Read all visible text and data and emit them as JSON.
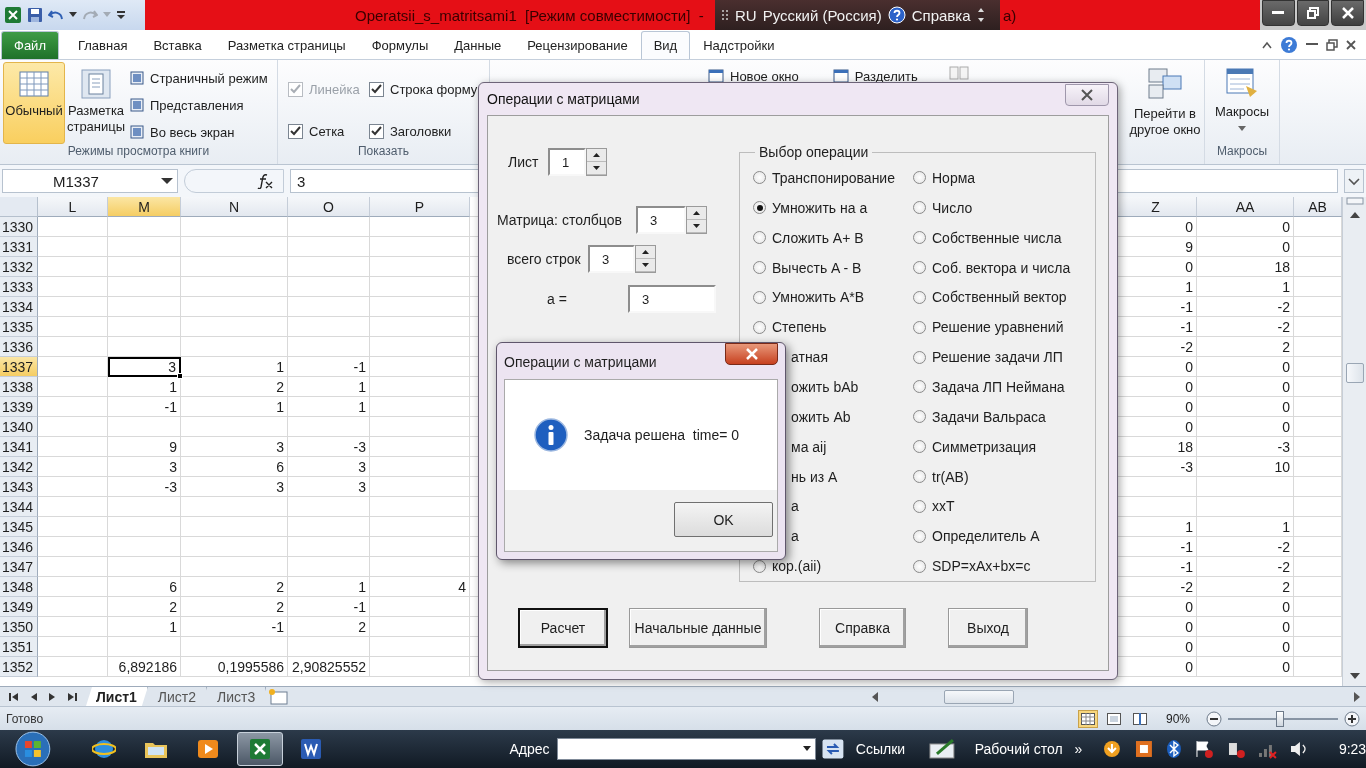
{
  "title_bar": {
    "title": "Operatsii_s_matritsami1  [Режим совместимости]  -",
    "title_tail": "a)"
  },
  "language_bar": {
    "code": "RU",
    "language": "Русский (Россия)",
    "help": "Справка"
  },
  "ribbon_tabs": [
    {
      "label": "Файл",
      "kind": "file",
      "selected": false
    },
    {
      "label": "Главная",
      "kind": "tab",
      "selected": false
    },
    {
      "label": "Вставка",
      "kind": "tab",
      "selected": false
    },
    {
      "label": "Разметка страницы",
      "kind": "tab",
      "selected": false
    },
    {
      "label": "Формулы",
      "kind": "tab",
      "selected": false
    },
    {
      "label": "Данные",
      "kind": "tab",
      "selected": false
    },
    {
      "label": "Рецензирование",
      "kind": "tab",
      "selected": false
    },
    {
      "label": "Вид",
      "kind": "tab",
      "selected": true
    },
    {
      "label": "Надстройки",
      "kind": "tab",
      "selected": false
    }
  ],
  "ribbon": {
    "views": {
      "label": "Режимы просмотра книги",
      "large_buttons": [
        {
          "label": "Обычный",
          "selected": true
        },
        {
          "label": "Разметка страницы",
          "selected": false
        }
      ],
      "small_buttons": [
        "Страничный режим",
        "Представления",
        "Во весь экран"
      ]
    },
    "show": {
      "label": "Показать",
      "checkboxes": [
        {
          "label": "Линейка",
          "checked": true,
          "disabled": true
        },
        {
          "label": "Строка форму",
          "checked": true,
          "disabled": false
        },
        {
          "label": "Сетка",
          "checked": true,
          "disabled": false
        },
        {
          "label": "Заголовки",
          "checked": true,
          "disabled": false
        }
      ]
    },
    "window": {
      "small_buttons": [
        "Новое окно",
        "Разделить"
      ],
      "switch_button": "Перейти в другое окно"
    },
    "macros": {
      "label": "Макросы",
      "button": "Макросы"
    }
  },
  "formula_bar": {
    "name_box": "M1337",
    "value": "3"
  },
  "columns": [
    {
      "label": "L",
      "selected": false
    },
    {
      "label": "M",
      "selected": true
    },
    {
      "label": "N",
      "selected": false
    },
    {
      "label": "O",
      "selected": false
    },
    {
      "label": "P",
      "selected": false
    },
    {
      "label": "Z",
      "selected": false
    },
    {
      "label": "AA",
      "selected": false
    },
    {
      "label": "AB",
      "selected": false
    }
  ],
  "rows": [
    {
      "number": "1330",
      "selected": false,
      "cells": [
        null,
        null,
        null,
        null,
        null,
        "0",
        "0",
        null
      ]
    },
    {
      "number": "1331",
      "selected": false,
      "cells": [
        null,
        null,
        null,
        null,
        null,
        "9",
        "0",
        null
      ]
    },
    {
      "number": "1332",
      "selected": false,
      "cells": [
        null,
        null,
        null,
        null,
        null,
        "0",
        "18",
        null
      ]
    },
    {
      "number": "1333",
      "selected": false,
      "cells": [
        null,
        null,
        null,
        null,
        null,
        "1",
        "1",
        null
      ]
    },
    {
      "number": "1334",
      "selected": false,
      "cells": [
        null,
        null,
        null,
        null,
        null,
        "-1",
        "-2",
        null
      ]
    },
    {
      "number": "1335",
      "selected": false,
      "cells": [
        null,
        null,
        null,
        null,
        null,
        "-1",
        "-2",
        null
      ]
    },
    {
      "number": "1336",
      "selected": false,
      "cells": [
        null,
        null,
        null,
        null,
        null,
        "-2",
        "2",
        null
      ]
    },
    {
      "number": "1337",
      "selected": true,
      "cells": [
        null,
        "3",
        "1",
        "-1",
        null,
        "0",
        "0",
        null
      ]
    },
    {
      "number": "1338",
      "selected": false,
      "cells": [
        null,
        "1",
        "2",
        "1",
        null,
        "0",
        "0",
        null
      ]
    },
    {
      "number": "1339",
      "selected": false,
      "cells": [
        null,
        "-1",
        "1",
        "1",
        null,
        "0",
        "0",
        null
      ]
    },
    {
      "number": "1340",
      "selected": false,
      "cells": [
        null,
        null,
        null,
        null,
        null,
        "0",
        "0",
        null
      ]
    },
    {
      "number": "1341",
      "selected": false,
      "cells": [
        null,
        "9",
        "3",
        "-3",
        null,
        "18",
        "-3",
        null
      ]
    },
    {
      "number": "1342",
      "selected": false,
      "cells": [
        null,
        "3",
        "6",
        "3",
        null,
        "-3",
        "10",
        null
      ]
    },
    {
      "number": "1343",
      "selected": false,
      "cells": [
        null,
        "-3",
        "3",
        "3",
        null,
        null,
        null,
        null
      ]
    },
    {
      "number": "1344",
      "selected": false,
      "cells": [
        null,
        null,
        null,
        null,
        null,
        null,
        null,
        null
      ]
    },
    {
      "number": "1345",
      "selected": false,
      "cells": [
        null,
        null,
        null,
        null,
        null,
        "1",
        "1",
        null
      ]
    },
    {
      "number": "1346",
      "selected": false,
      "cells": [
        null,
        null,
        null,
        null,
        null,
        "-1",
        "-2",
        null
      ]
    },
    {
      "number": "1347",
      "selected": false,
      "cells": [
        null,
        null,
        null,
        null,
        null,
        "-1",
        "-2",
        null
      ]
    },
    {
      "number": "1348",
      "selected": false,
      "cells": [
        null,
        "6",
        "2",
        "1",
        "4",
        "-2",
        "2",
        null
      ]
    },
    {
      "number": "1349",
      "selected": false,
      "cells": [
        null,
        "2",
        "2",
        "-1",
        null,
        "0",
        "0",
        null
      ]
    },
    {
      "number": "1350",
      "selected": false,
      "cells": [
        null,
        "1",
        "-1",
        "2",
        null,
        "0",
        "0",
        null
      ]
    },
    {
      "number": "1351",
      "selected": false,
      "cells": [
        null,
        null,
        null,
        null,
        null,
        "0",
        "0",
        null
      ]
    },
    {
      "number": "1352",
      "selected": false,
      "cells": [
        null,
        "6,892186",
        "0,1995586",
        "2,90825552",
        null,
        "0",
        "0",
        null
      ]
    }
  ],
  "sheet_tabs": [
    {
      "label": "Лист1",
      "selected": true
    },
    {
      "label": "Лист2",
      "selected": false
    },
    {
      "label": "Лист3",
      "selected": false
    }
  ],
  "status_bar": {
    "status": "Готово",
    "zoom": "90%",
    "zoom_slider": {
      "level": 0.47
    }
  },
  "dialog": {
    "title": "Операции с матрицами",
    "fields": [
      {
        "label": "Лист",
        "value": "1",
        "kind": "spinner"
      },
      {
        "label": "Матрица: столбцов",
        "value": "3",
        "kind": "spinner"
      },
      {
        "label": "всего строк",
        "value": "3",
        "kind": "spinner"
      },
      {
        "label": "a =",
        "value": "3",
        "kind": "text"
      }
    ],
    "frame_title": "Выбор операции",
    "left_options": [
      {
        "label": "Транспонирование",
        "kind": "radio",
        "selected": false
      },
      {
        "label": "Умножить на a",
        "kind": "radio",
        "selected": true
      },
      {
        "label": "Сложить A+ B",
        "kind": "radio",
        "selected": false
      },
      {
        "label": "Вычесть A - B",
        "kind": "radio",
        "selected": false
      },
      {
        "label": "Умножить A*B",
        "kind": "radio",
        "selected": false
      },
      {
        "label": "Степень",
        "kind": "radio",
        "selected": false
      },
      {
        "label": "атная",
        "kind": "covered"
      },
      {
        "label": "ожить bAb",
        "kind": "covered"
      },
      {
        "label": "ожить Ab",
        "kind": "covered"
      },
      {
        "label": "ма aij",
        "kind": "covered"
      },
      {
        "label": "нь из A",
        "kind": "covered"
      },
      {
        "label": "а",
        "kind": "covered"
      },
      {
        "label": "а",
        "kind": "covered"
      },
      {
        "label": "кор.(aii)",
        "kind": "radio",
        "selected": false
      }
    ],
    "right_options": [
      {
        "label": "Норма",
        "kind": "radio",
        "selected": false
      },
      {
        "label": "Число",
        "kind": "radio",
        "selected": false
      },
      {
        "label": "Собственные числа",
        "kind": "radio",
        "selected": false
      },
      {
        "label": "Соб. вектора и числа",
        "kind": "radio",
        "selected": false
      },
      {
        "label": "Собственный вектор",
        "kind": "radio",
        "selected": false
      },
      {
        "label": "Решение уравнений",
        "kind": "radio",
        "selected": false
      },
      {
        "label": "Решение задачи ЛП",
        "kind": "radio",
        "selected": false
      },
      {
        "label": "Задача ЛП Неймана",
        "kind": "radio",
        "selected": false
      },
      {
        "label": "Задачи Вальраса",
        "kind": "radio",
        "selected": false
      },
      {
        "label": "Симметризация",
        "kind": "radio",
        "selected": false
      },
      {
        "label": "tr(AB)",
        "kind": "radio",
        "selected": false
      },
      {
        "label": "xxT",
        "kind": "radio",
        "selected": false
      },
      {
        "label": "Определитель A",
        "kind": "radio",
        "selected": false
      },
      {
        "label": "SDP=xAx+bx=c",
        "kind": "radio",
        "selected": false
      }
    ],
    "buttons": [
      {
        "label": "Расчет",
        "default": true
      },
      {
        "label": "Начальные данные",
        "default": false
      },
      {
        "label": "Справка",
        "default": false
      },
      {
        "label": "Выход",
        "default": false
      }
    ]
  },
  "message_box": {
    "title": "Операции с матрицами",
    "message": "Задача решена  time= 0",
    "button": "OK"
  },
  "taskbar": {
    "apps": [
      {
        "selected": false
      },
      {
        "selected": false
      },
      {
        "selected": false
      },
      {
        "selected": true
      },
      {
        "selected": false
      }
    ],
    "address_label": "Адрес",
    "links": "Ссылки",
    "desktop": "Рабочий стол",
    "more": "»",
    "clock": "9:23"
  }
}
